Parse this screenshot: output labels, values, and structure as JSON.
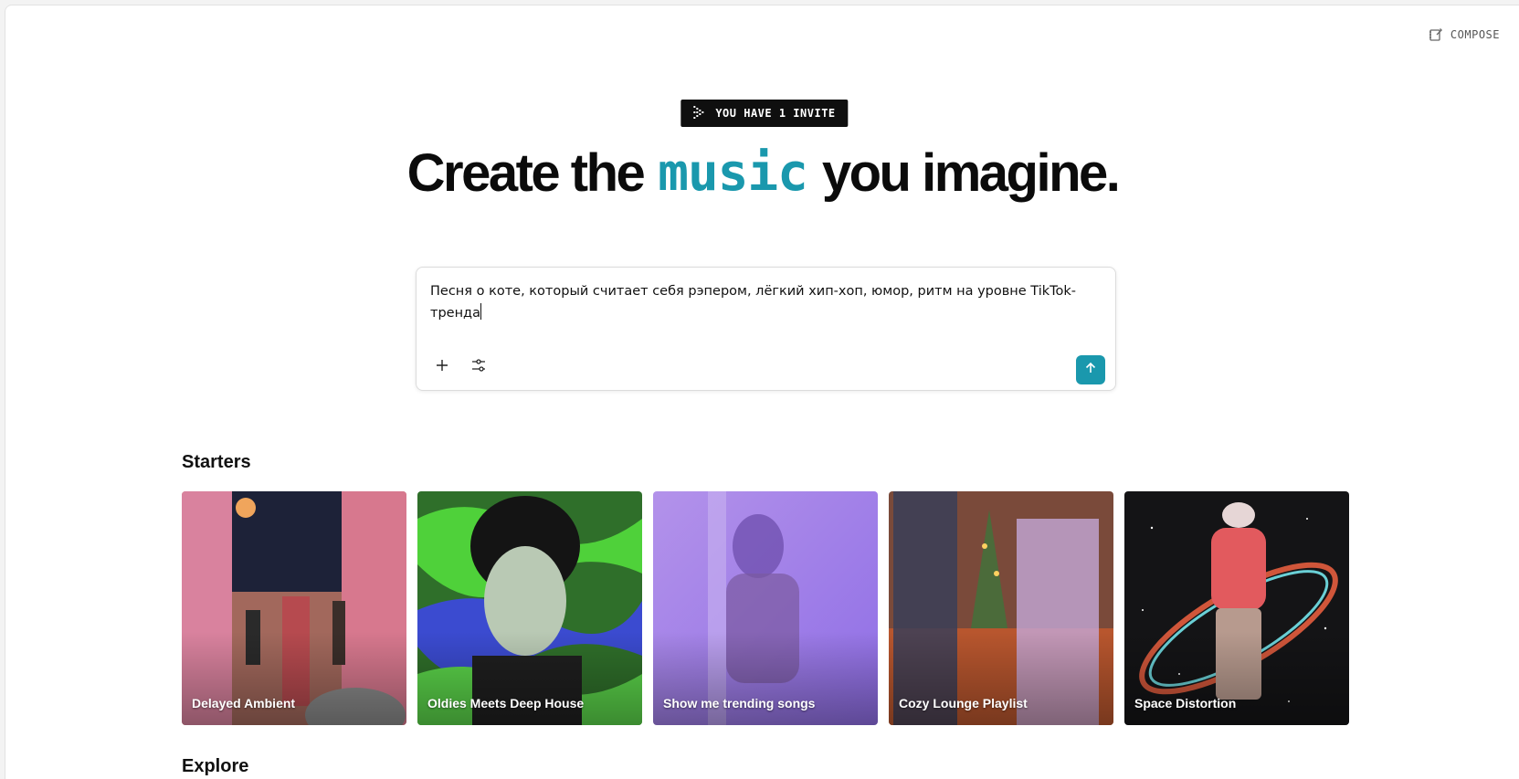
{
  "header": {
    "compose_label": "COMPOSE",
    "compose_icon": "compose-icon"
  },
  "invite": {
    "label": "YOU HAVE 1 INVITE",
    "icon": "pixel-arrow-icon"
  },
  "headline": {
    "before": "Create the",
    "accent": "music",
    "after": "you imagine."
  },
  "prompt": {
    "value": "Песня о коте, который считает себя рэпером, лёгкий хип-хоп, юмор, ритм на уровне TikTok-тренда",
    "add_icon": "plus-icon",
    "settings_icon": "sliders-icon",
    "send_icon": "arrow-up-icon"
  },
  "starters": {
    "title": "Starters",
    "cards": [
      {
        "label": "Delayed Ambient"
      },
      {
        "label": "Oldies Meets Deep House"
      },
      {
        "label": "Show me trending songs"
      },
      {
        "label": "Cozy Lounge Playlist"
      },
      {
        "label": "Space Distortion"
      }
    ]
  },
  "explore": {
    "title": "Explore"
  },
  "colors": {
    "accent": "#1a98ad",
    "invite_bg": "#0f0f0f"
  }
}
